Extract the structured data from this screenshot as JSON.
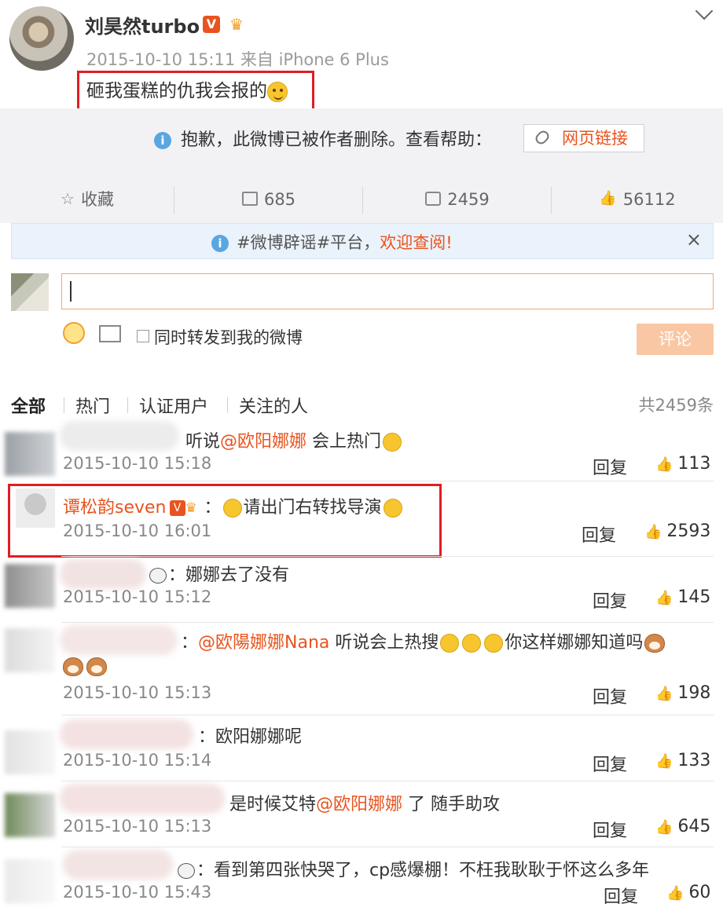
{
  "post": {
    "author": "刘昊然turbo",
    "verified": "V",
    "crown_icon": "crown-badge-icon",
    "meta": "2015-10-10 15:11 来自 iPhone 6 Plus",
    "text": "砸我蛋糕的仇我会报的"
  },
  "deleted_notice": {
    "text": "抱歉，此微博已被作者删除。查看帮助：",
    "link_label": "网页链接",
    "info_icon": "i"
  },
  "actions": {
    "favorite": "收藏",
    "repost_count": "685",
    "comment_count": "2459",
    "like_count": "56112"
  },
  "rumor_banner": {
    "prefix": "#微博辟谣#平台，",
    "highlight": "欢迎查阅!",
    "close": "×"
  },
  "compose": {
    "repost_label": "同时转发到我的微博",
    "submit_label": "评论"
  },
  "tabs": {
    "all": "全部",
    "hot": "热门",
    "verified": "认证用户",
    "following": "关注的人",
    "total": "共2459条"
  },
  "comments": [
    {
      "pre": "听说",
      "at": "@欧阳娜娜",
      "post": " 会上热门",
      "time": "2015-10-10 15:18",
      "reply": "回复",
      "likes": "113"
    },
    {
      "name": "谭松韵seven",
      "sep": "：",
      "text": "请出门右转找导演",
      "time": "2015-10-10 16:01",
      "reply": "回复",
      "likes": "2593"
    },
    {
      "text": "：娜娜去了没有",
      "time": "2015-10-10 15:12",
      "reply": "回复",
      "likes": "145"
    },
    {
      "sep": "：",
      "at": "@欧陽娜娜Nana",
      "post": " 听说会上热搜",
      "tail": "你这样娜娜知道吗",
      "time": "2015-10-10 15:13",
      "reply": "回复",
      "likes": "198"
    },
    {
      "text": "：欧阳娜娜呢",
      "time": "2015-10-10 15:14",
      "reply": "回复",
      "likes": "133"
    },
    {
      "pre": "是时候艾特",
      "at": "@欧阳娜娜",
      "post": " 了 随手助攻",
      "time": "2015-10-10 15:13",
      "reply": "回复",
      "likes": "645"
    },
    {
      "text": "：看到第四张快哭了，cp感爆棚！不枉我耿耿于怀这么多年",
      "time": "2015-10-10 15:43",
      "reply": "回复",
      "likes": "60"
    }
  ],
  "colors": {
    "accent": "#e8541e",
    "highlight_border": "#e01d24",
    "bar_bg": "#f2f2f5"
  }
}
